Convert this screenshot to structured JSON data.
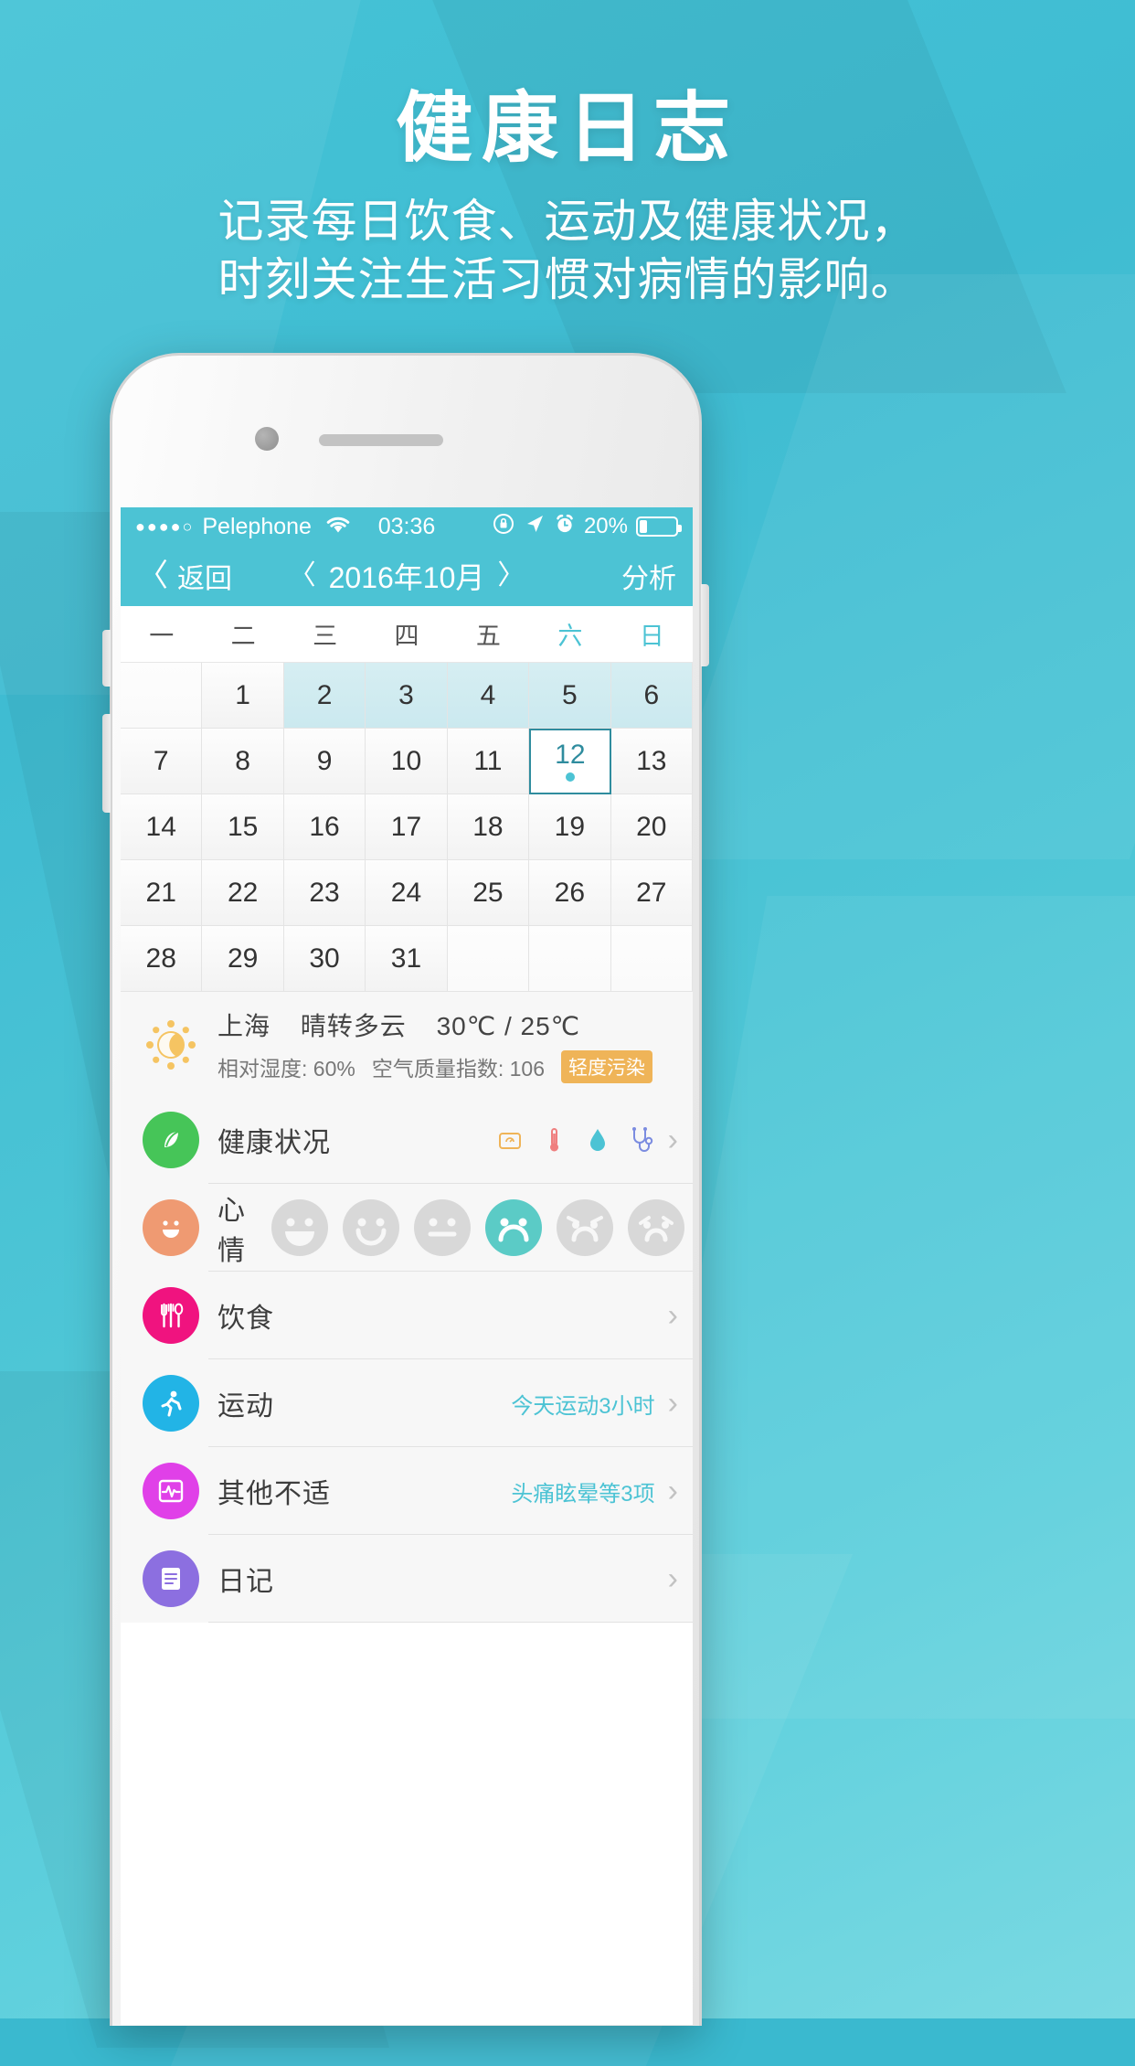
{
  "promo": {
    "title": "健康日志",
    "subtitle_line1": "记录每日饮食、运动及健康状况，",
    "subtitle_line2": "时刻关注生活习惯对病情的影响。",
    "accent_color": "#4cc3d4",
    "background_color": "#45c3d6"
  },
  "statusbar": {
    "signal_dots": "●●●●○",
    "carrier": "Pelephone",
    "wifi_icon": "wifi-icon",
    "time": "03:36",
    "rotation_lock_icon": "rotation-lock-icon",
    "location_icon": "location-arrow-icon",
    "alarm_icon": "alarm-clock-icon",
    "battery_percent": "20%",
    "battery_level": 20
  },
  "navbar": {
    "back_label": "返回",
    "back_icon": "chevron-left-icon",
    "prev_icon": "chevron-left-icon",
    "title": "2016年10月",
    "next_icon": "chevron-right-icon",
    "right_action": "分析"
  },
  "calendar": {
    "weekdays": [
      "一",
      "二",
      "三",
      "四",
      "五",
      "六",
      "日"
    ],
    "weekend_indices": [
      5,
      6
    ],
    "selected_day": 12,
    "selected_has_dot": true,
    "highlight_days": [
      2,
      3,
      4,
      5,
      6
    ],
    "weeks": [
      [
        "",
        "1",
        "2",
        "3",
        "4",
        "5",
        "6"
      ],
      [
        "7",
        "8",
        "9",
        "10",
        "11",
        "12",
        "13"
      ],
      [
        "14",
        "15",
        "16",
        "17",
        "18",
        "19",
        "20"
      ],
      [
        "21",
        "22",
        "23",
        "24",
        "25",
        "26",
        "27"
      ],
      [
        "28",
        "29",
        "30",
        "31",
        "",
        "",
        ""
      ]
    ]
  },
  "weather": {
    "icon": "sun-moon-icon",
    "city": "上海",
    "condition": "晴转多云",
    "temperature": "30℃ / 25℃",
    "humidity_label": "相对湿度: 60%",
    "aqi_label": "空气质量指数: 106",
    "aqi_badge": "轻度污染",
    "aqi_badge_color": "#efb458"
  },
  "rows": [
    {
      "name": "health-status",
      "icon": "leaf-icon",
      "icon_color": "#46c558",
      "label": "健康状况",
      "mini_icons": [
        "weight-scale-icon",
        "thermometer-icon",
        "blood-drop-icon",
        "stethoscope-icon"
      ],
      "value": "",
      "arrow": "›"
    },
    {
      "name": "mood",
      "icon": "smiley-icon",
      "icon_color": "#ef9a72",
      "label": "心情",
      "moods": [
        "laugh",
        "smile",
        "neutral",
        "frown",
        "sad",
        "cry"
      ],
      "selected_mood_index": 3,
      "selected_mood_color": "#5bcbc6",
      "value": "",
      "arrow": ""
    },
    {
      "name": "diet",
      "icon": "cutlery-icon",
      "icon_color": "#f0137f",
      "label": "饮食",
      "value": "",
      "arrow": "›"
    },
    {
      "name": "exercise",
      "icon": "runner-icon",
      "icon_color": "#22b4e6",
      "label": "运动",
      "value": "今天运动3小时",
      "arrow": "›"
    },
    {
      "name": "other-discomfort",
      "icon": "heartbeat-icon",
      "icon_color": "#e040e8",
      "label": "其他不适",
      "value": "头痛眩晕等3项",
      "arrow": "›"
    },
    {
      "name": "diary",
      "icon": "note-icon",
      "icon_color": "#8c6fe0",
      "label": "日记",
      "value": "",
      "arrow": "›"
    }
  ]
}
